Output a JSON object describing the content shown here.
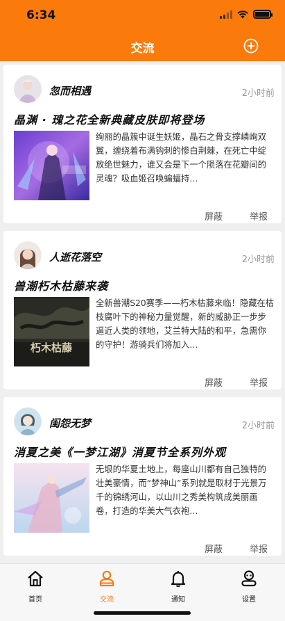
{
  "status_bar": {
    "time": "6:34"
  },
  "nav": {
    "title": "交流",
    "add_icon": "plus-circle-icon"
  },
  "posts": [
    {
      "user": "忽而相遇",
      "time": "2小时前",
      "title": "晶渊 · 瑰之花全新典藏皮肤即将登场",
      "text": "绚丽的晶簇中诞生妖姬，晶石之骨支撑嶙峋双翼，缠绕着布满钩刺的惨白荆棘，在死亡中绽放绝世魅力，谁又会是下一个陨落在花瓣间的灵魂？吸血姬召唤蝙蝠持…",
      "block": "屏蔽",
      "report": "举报"
    },
    {
      "user": "人逝花落空",
      "time": "2小时前",
      "title": "兽潮朽木枯藤来袭",
      "text": "全新兽潮S20赛季——朽木枯藤来临！隐藏在枯枝腐叶下的神秘力量觉醒，新的威胁正一步步逼近人类的领地，艾兰特大陆的和平，急需你的守护！游骑兵们将加入…",
      "thumb_text": "朽木枯藤",
      "block": "屏蔽",
      "report": "举报"
    },
    {
      "user": "闺怨无梦",
      "time": "2小时前",
      "title": "消夏之美《一梦江湖》消夏节全系列外观",
      "text": "无垠的华夏土地上，每座山川都有自己独特的壮美豪情，而“梦神山”系列就是取材于光景万千的锦绣河山，以山川之秀美构筑成美丽画卷，打造的华美大气衣袍…",
      "block": "屏蔽",
      "report": "举报"
    }
  ],
  "tabs": [
    {
      "label": "首页",
      "icon": "home-icon"
    },
    {
      "label": "交流",
      "icon": "user-icon",
      "active": true
    },
    {
      "label": "通知",
      "icon": "bell-icon"
    },
    {
      "label": "设置",
      "icon": "settings-user-icon"
    }
  ],
  "colors": {
    "brand": "#fb7a0c"
  }
}
